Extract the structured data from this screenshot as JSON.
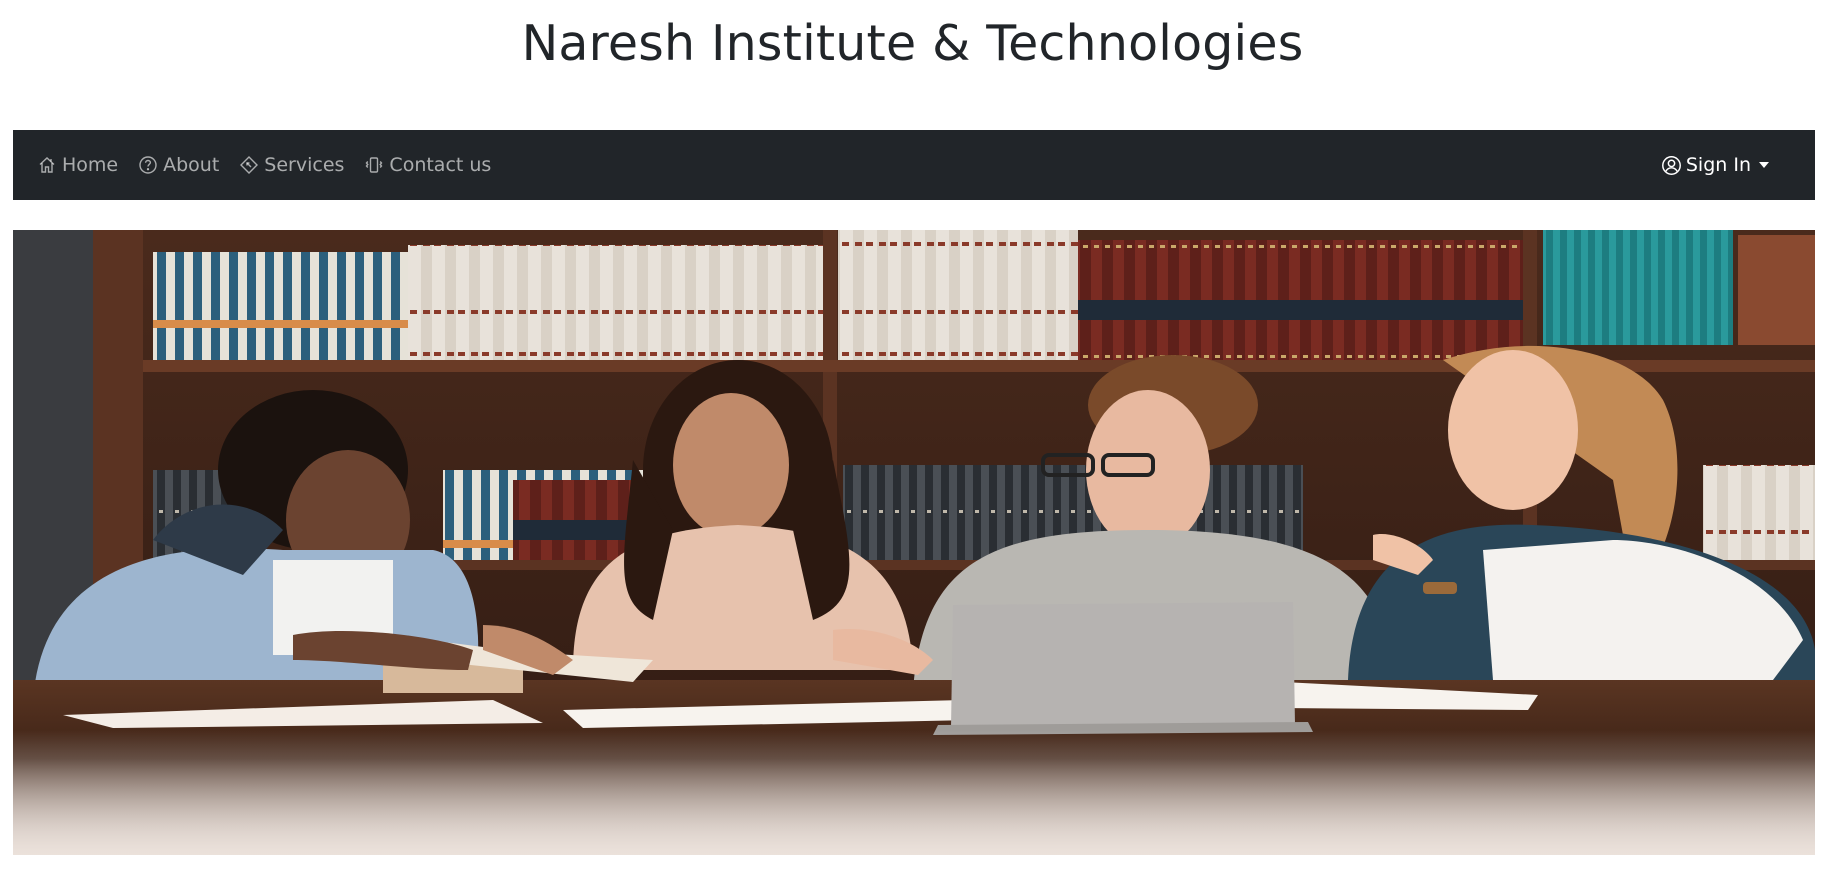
{
  "page": {
    "title": "Naresh Institute & Technologies"
  },
  "navbar": {
    "background": "#212529",
    "items": [
      {
        "label": "Home",
        "icon": "house-icon"
      },
      {
        "label": "About",
        "icon": "question-circle-icon"
      },
      {
        "label": "Services",
        "icon": "tag-diamond-icon"
      },
      {
        "label": "Contact us",
        "icon": "phone-vibrate-icon"
      }
    ],
    "signin": {
      "label": "Sign In",
      "icon": "person-circle-icon"
    }
  },
  "hero": {
    "description": "Four students studying together at a library table with a laptop and books"
  }
}
